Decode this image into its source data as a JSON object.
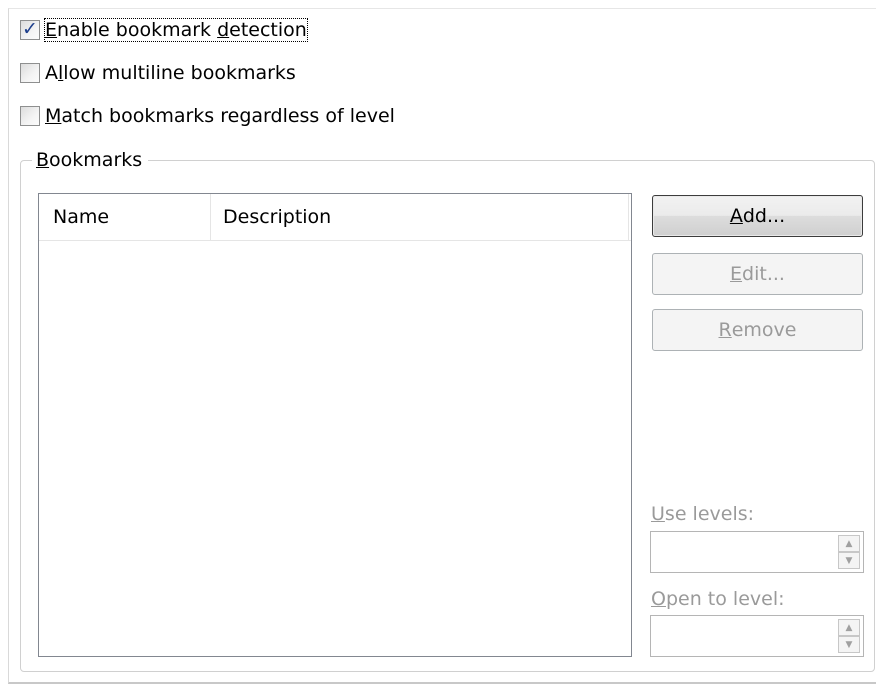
{
  "options": {
    "enable_detection": {
      "label_pre": "",
      "label_u": "E",
      "label_mid": "nable bookmark ",
      "label_u2": "d",
      "label_post": "etection",
      "checked": true
    },
    "allow_multiline": {
      "label_pre": "A",
      "label_u": "l",
      "label_post": "low multiline bookmarks",
      "checked": false
    },
    "match_regardless": {
      "label_u": "M",
      "label_post": "atch bookmarks regardless of level",
      "checked": false
    }
  },
  "group": {
    "title_u": "B",
    "title_rest": "ookmarks"
  },
  "list": {
    "columns": [
      "Name",
      "Description"
    ],
    "rows": []
  },
  "buttons": {
    "add": {
      "u": "A",
      "rest": "dd..."
    },
    "edit": {
      "u": "E",
      "rest": "dit..."
    },
    "remove": {
      "u": "R",
      "rest": "emove"
    }
  },
  "levels": {
    "use_levels_u": "U",
    "use_levels_rest": "se levels:",
    "use_levels_value": "",
    "open_to_u": "O",
    "open_to_rest": "pen to level:",
    "open_to_value": ""
  },
  "icons": {
    "check": "✓",
    "spin_up": "▲",
    "spin_down": "▼"
  }
}
